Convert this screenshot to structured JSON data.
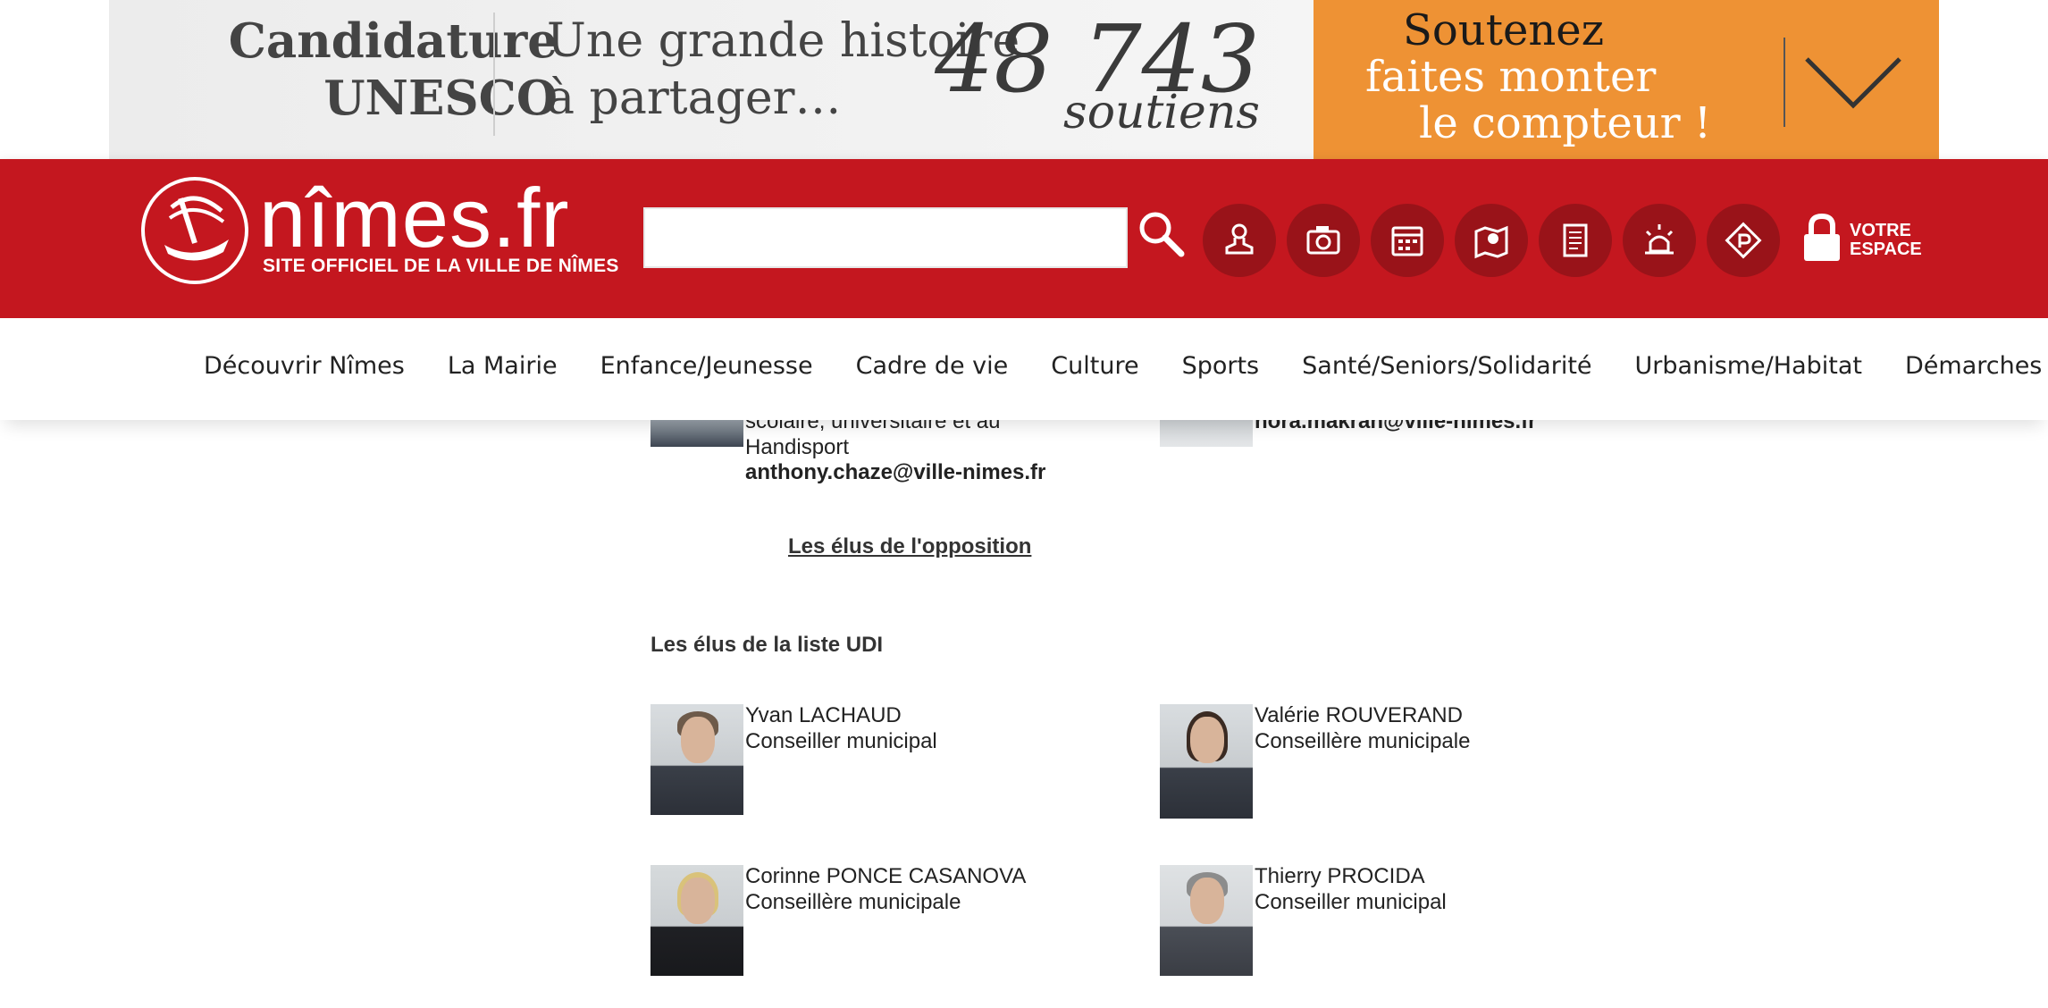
{
  "unesco_banner": {
    "title_line1": "Candidature",
    "title_line2": "UNESCO",
    "tagline_line1": "Une grande histoire",
    "tagline_line2": "à partager…",
    "count": "48 743",
    "count_unit": "soutiens",
    "cta_line1": "Soutenez",
    "cta_line2": "faites monter",
    "cta_line3": "le compteur !",
    "cta_icon": "chevron-down-icon",
    "bg_color": "#f0f0f0",
    "cta_color": "#ee9234"
  },
  "header": {
    "logo_text": "nîmes.fr",
    "logo_subtitle": "SITE OFFICIEL DE LA VILLE DE NÎMES",
    "search_placeholder": "",
    "search_icon": "search-icon",
    "quick_icons": [
      "stamp-icon",
      "camera-icon",
      "calendar-icon",
      "map-icon",
      "document-icon",
      "alert-icon",
      "parking-icon"
    ],
    "account_line1": "VOTRE",
    "account_line2": "ESPACE",
    "account_icon": "lock-icon",
    "bg_color": "#c4171f"
  },
  "nav": {
    "items": [
      "Découvrir Nîmes",
      "La Mairie",
      "Enfance/Jeunesse",
      "Cadre de vie",
      "Culture",
      "Sports",
      "Santé/Seniors/Solidarité",
      "Urbanisme/Habitat",
      "Démarches"
    ]
  },
  "content": {
    "partial_left": {
      "line1": "scolaire, universitaire et au",
      "line2": "Handisport",
      "email": "anthony.chaze@ville-nimes.fr"
    },
    "partial_right": {
      "email": "nora.makran@ville-nimes.fr"
    },
    "opposition_link": "Les élus de l'opposition",
    "udi_heading": "Les élus de la liste UDI",
    "members": [
      {
        "name": "Yvan LACHAUD",
        "role": "Conseiller municipal"
      },
      {
        "name": "Valérie ROUVERAND",
        "role": "Conseillère municipale"
      },
      {
        "name": "Corinne PONCE CASANOVA",
        "role": "Conseillère municipale"
      },
      {
        "name": "Thierry PROCIDA",
        "role": "Conseiller municipal"
      }
    ]
  }
}
